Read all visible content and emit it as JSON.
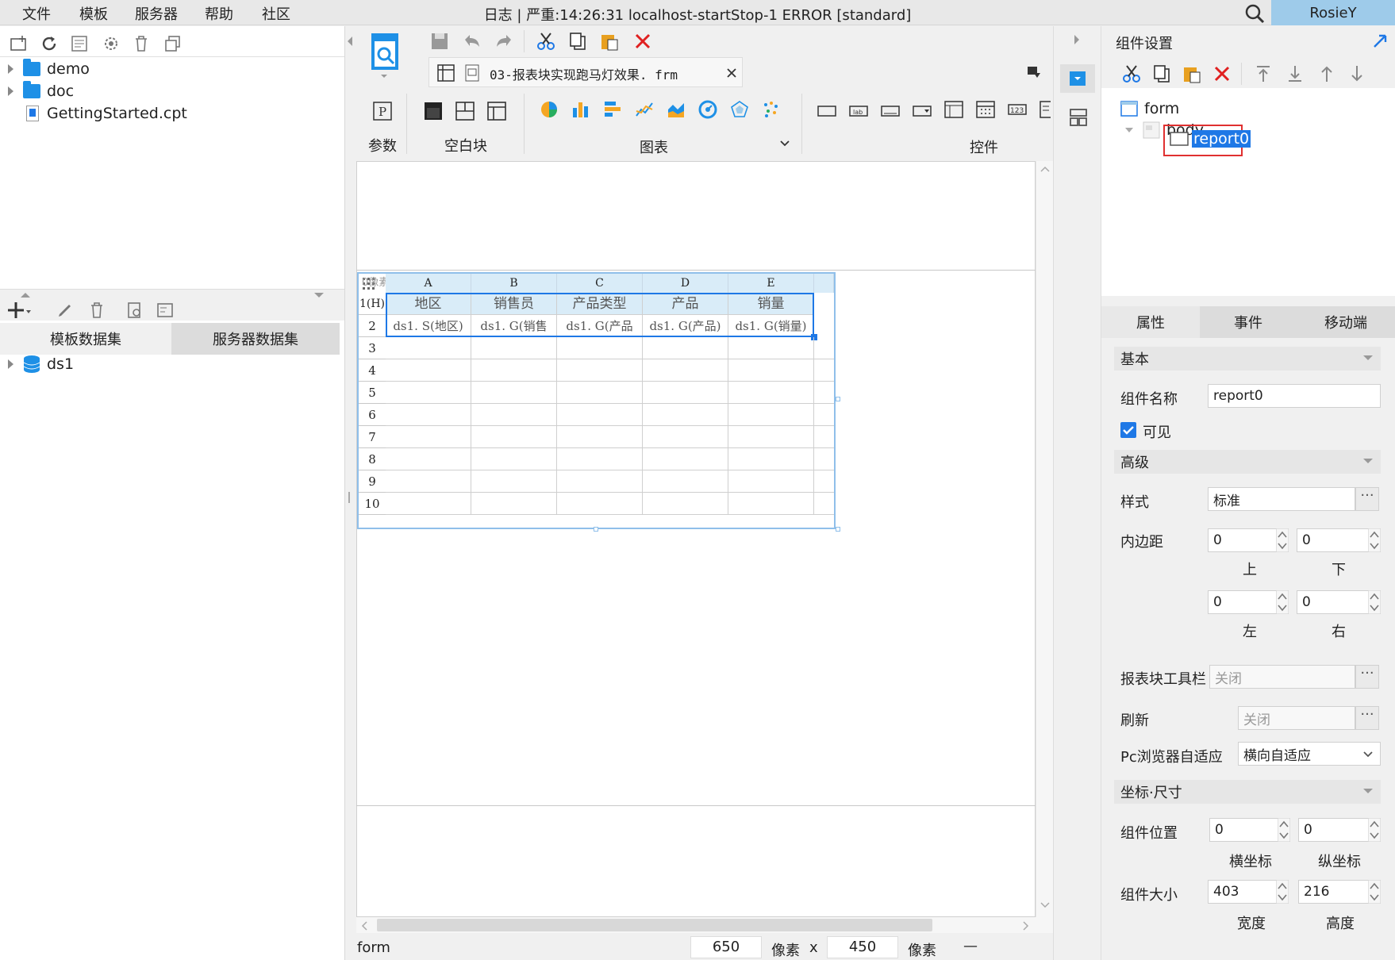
{
  "menu": [
    "文件",
    "模板",
    "服务器",
    "帮助",
    "社区"
  ],
  "title": "日志 | 严重:14:26:31 localhost-startStop-1 ERROR [standard]",
  "user": "RosieY",
  "icons": {
    "search": "search-icon"
  },
  "file_tree": [
    {
      "label": "demo",
      "type": "folder"
    },
    {
      "label": "doc",
      "type": "folder"
    },
    {
      "label": "GettingStarted.cpt",
      "type": "file"
    }
  ],
  "dataset_tabs": [
    "模板数据集",
    "服务器数据集"
  ],
  "datasets": [
    "ds1"
  ],
  "editor_tab": "03-报表块实现跑马灯效果. frm",
  "widget_groups": {
    "param": "参数",
    "blank": "空白块",
    "chart": "图表",
    "control": "控件"
  },
  "grid": {
    "label": "0像素",
    "columns": [
      "A",
      "B",
      "C",
      "D",
      "E"
    ],
    "rows": [
      "1(H)",
      "2",
      "3",
      "4",
      "5",
      "6",
      "7",
      "8",
      "9",
      "10"
    ],
    "header_row": [
      "地区",
      "销售员",
      "产品类型",
      "产品",
      "销量"
    ],
    "data_row": [
      "ds1. S(地区)",
      "ds1. G(销售",
      "ds1. G(产品",
      "ds1. G(产品)",
      "ds1. G(销量)"
    ]
  },
  "status": {
    "form": "form",
    "width": "650",
    "unit": "像素",
    "x": "x",
    "height": "450",
    "unit2": "像素",
    "minus": "—"
  },
  "right": {
    "title": "组件设置",
    "tree": {
      "form": "form",
      "body": "body",
      "report": "report0"
    },
    "tabs": [
      "属性",
      "事件",
      "移动端"
    ],
    "sections": {
      "basic": "基本",
      "advanced": "高级",
      "coords": "坐标·尺寸"
    },
    "name_label": "组件名称",
    "name_value": "report0",
    "visible_label": "可见",
    "style_label": "样式",
    "style_value": "标准",
    "padding_label": "内边距",
    "padding": {
      "top": "0",
      "bottom": "0",
      "left": "0",
      "right": "0"
    },
    "padding_sub": {
      "top": "上",
      "bottom": "下",
      "left": "左",
      "right": "右"
    },
    "toolbar_label": "报表块工具栏",
    "toolbar_value": "关闭",
    "refresh_label": "刷新",
    "refresh_value": "关闭",
    "adapt_label": "Pc浏览器自适应",
    "adapt_value": "横向自适应",
    "pos_label": "组件位置",
    "pos": {
      "x": "0",
      "y": "0"
    },
    "pos_sub": {
      "x": "横坐标",
      "y": "纵坐标"
    },
    "size_label": "组件大小",
    "size": {
      "w": "403",
      "h": "216"
    },
    "size_sub": {
      "w": "宽度",
      "h": "高度"
    },
    "dots": "···"
  },
  "colors": {
    "accent": "#1e90e6",
    "selection": "#1e78e6",
    "highlight": "#e03030",
    "header": "#d9ecf8"
  }
}
